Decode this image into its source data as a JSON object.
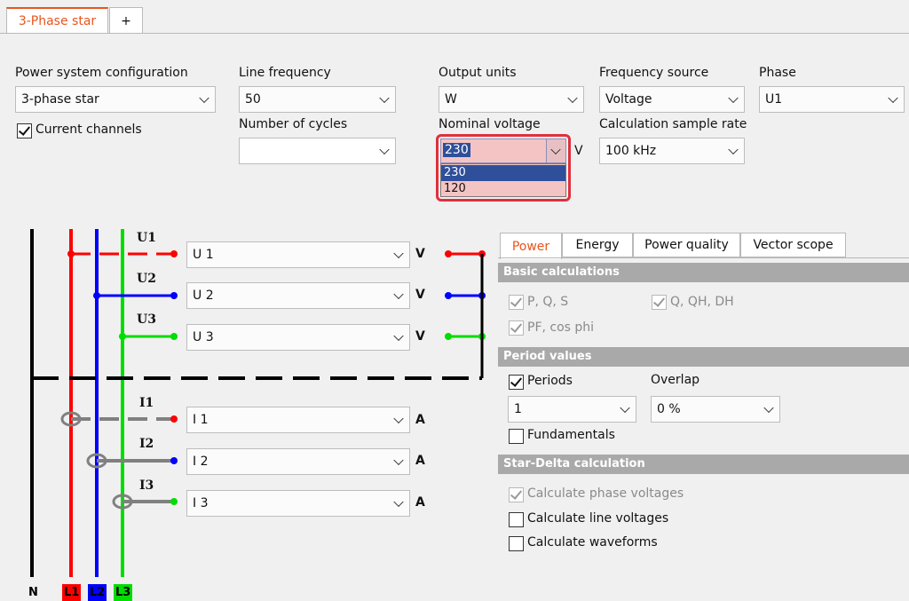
{
  "tabs": {
    "active": "3-Phase star",
    "add": "+"
  },
  "config": {
    "power_system_label": "Power system configuration",
    "power_system_value": "3-phase star",
    "current_channels_label": "Current channels",
    "current_channels_checked": true,
    "line_freq_label": "Line frequency",
    "line_freq_value": "50",
    "num_cycles_label": "Number of cycles",
    "num_cycles_value": "",
    "output_units_label": "Output units",
    "output_units_value": "W",
    "nominal_voltage_label": "Nominal voltage",
    "nominal_voltage_value": "230",
    "nominal_voltage_unit": "V",
    "nominal_voltage_options": [
      "230",
      "120"
    ],
    "freq_source_label": "Frequency source",
    "freq_source_value": "Voltage",
    "sample_rate_label": "Calculation sample rate",
    "sample_rate_value": "100 kHz",
    "phase_label": "Phase",
    "phase_value": "U1"
  },
  "diagram": {
    "voltage_rows": [
      {
        "label": "U1",
        "value": "U 1",
        "unit": "V",
        "color": "#ff0000"
      },
      {
        "label": "U2",
        "value": "U 2",
        "unit": "V",
        "color": "#0000ff"
      },
      {
        "label": "U3",
        "value": "U 3",
        "unit": "V",
        "color": "#00dd00"
      }
    ],
    "current_rows": [
      {
        "label": "I1",
        "value": "I 1",
        "unit": "A",
        "color": "#ff0000"
      },
      {
        "label": "I2",
        "value": "I 2",
        "unit": "A",
        "color": "#0000ff"
      },
      {
        "label": "I3",
        "value": "I 3",
        "unit": "A",
        "color": "#00dd00"
      }
    ],
    "buses": [
      {
        "label": "N",
        "color": "#000000"
      },
      {
        "label": "L1",
        "color": "#ff0000"
      },
      {
        "label": "L2",
        "color": "#0000ff"
      },
      {
        "label": "L3",
        "color": "#00dd00"
      }
    ]
  },
  "right_tabs": [
    "Power",
    "Energy",
    "Power quality",
    "Vector scope"
  ],
  "basic": {
    "title": "Basic calculations",
    "pqs": "P, Q, S",
    "qqhdh": "Q, QH, DH",
    "pf": "PF, cos phi"
  },
  "period": {
    "title": "Period values",
    "periods_label": "Periods",
    "periods_checked": true,
    "overlap_label": "Overlap",
    "periods_value": "1",
    "overlap_value": "0 %",
    "fundamentals_label": "Fundamentals"
  },
  "stardelta": {
    "title": "Star-Delta calculation",
    "phase_voltages": "Calculate phase voltages",
    "line_voltages": "Calculate line voltages",
    "waveforms": "Calculate waveforms"
  }
}
